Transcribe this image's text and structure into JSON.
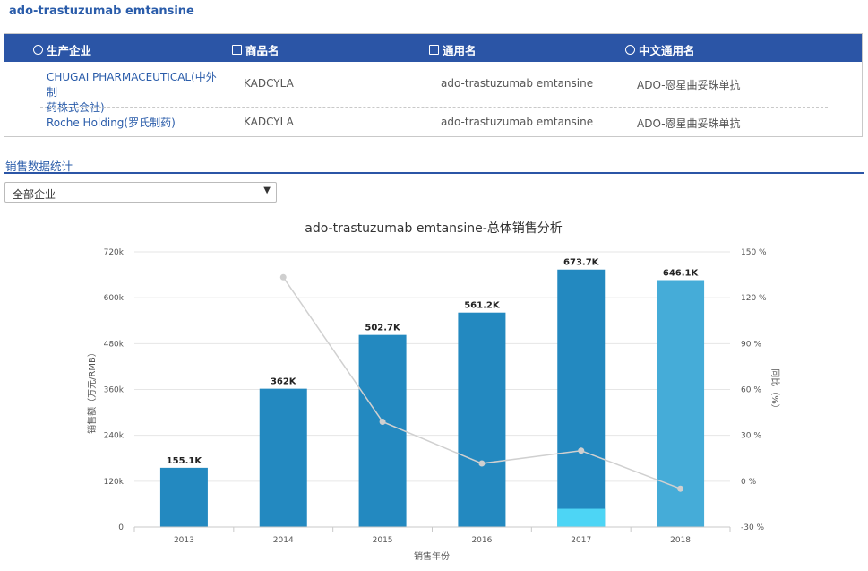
{
  "drug_title": "ado-trastuzumab emtansine",
  "table": {
    "headers": [
      "生产企业",
      "商品名",
      "通用名",
      "中文通用名"
    ],
    "rows": [
      {
        "company_line1": "CHUGAI PHARMACEUTICAL(中外制",
        "company_line2": "药株式会社)",
        "brand": "KADCYLA",
        "generic": "ado-trastuzumab emtansine",
        "chinese": "ADO-恩星曲妥珠单抗"
      },
      {
        "company_line1": "Roche Holding(罗氏制药)",
        "company_line2": "",
        "brand": "KADCYLA",
        "generic": "ado-trastuzumab emtansine",
        "chinese": "ADO-恩星曲妥珠单抗"
      }
    ]
  },
  "section_title": "销售数据统计",
  "filter": {
    "selected": "全部企业"
  },
  "chart_data": {
    "type": "bar",
    "title": "ado-trastuzumab emtansine-总体销售分析",
    "xlabel": "销售年份",
    "ylabel": "销售额（万元/RMB）",
    "y2label": "同比（%）",
    "categories": [
      "2013",
      "2014",
      "2015",
      "2016",
      "2017",
      "2018"
    ],
    "values": [
      155.1,
      362,
      502.7,
      561.2,
      673.7,
      646.1
    ],
    "data_labels": [
      "155.1K",
      "362K",
      "502.7K",
      "561.2K",
      "673.7K",
      "646.1K"
    ],
    "segment_2017_light": 48,
    "ylim": [
      0,
      720
    ],
    "yticks": [
      "0",
      "120k",
      "240k",
      "360k",
      "480k",
      "600k",
      "720k"
    ],
    "y2lim": [
      -30,
      150
    ],
    "y2ticks": [
      "-30 %",
      "0 %",
      "30 %",
      "60 %",
      "90 %",
      "120 %",
      "150 %"
    ],
    "growth": [
      null,
      133.4,
      38.9,
      11.6,
      20.0,
      -4.9
    ],
    "colors": {
      "bar": "#2389c0",
      "bar_last": "#45acd8",
      "segment_light": "#4dd5f5",
      "line": "#d0d0d0",
      "point": "#cfcfcf"
    }
  }
}
